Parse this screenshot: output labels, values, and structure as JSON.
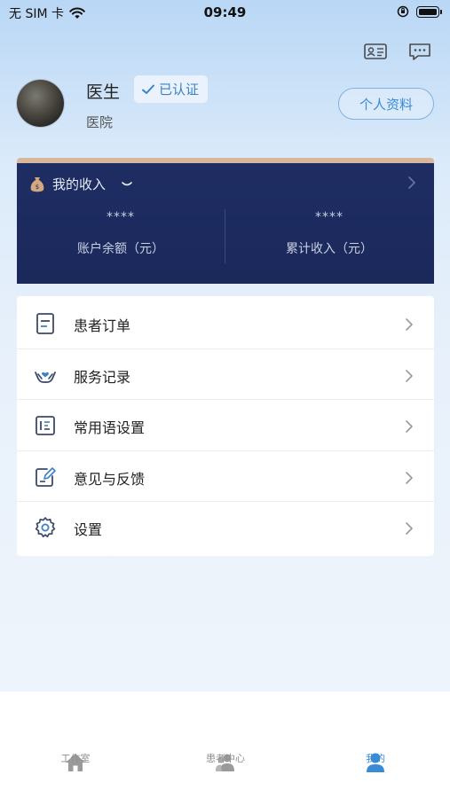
{
  "status_bar": {
    "carrier": "无 SIM 卡",
    "time": "09:49"
  },
  "profile": {
    "name": "医生",
    "verified_label": "已认证",
    "hospital": "医院",
    "profile_button": "个人资料"
  },
  "income": {
    "title": "我的收入",
    "balance_value": "****",
    "balance_label": "账户余额（元）",
    "total_value": "****",
    "total_label": "累计收入（元）"
  },
  "menu": {
    "items": [
      {
        "label": "患者订单",
        "icon": "document-icon"
      },
      {
        "label": "服务记录",
        "icon": "care-hands-icon"
      },
      {
        "label": "常用语设置",
        "icon": "phrase-icon"
      },
      {
        "label": "意见与反馈",
        "icon": "feedback-edit-icon"
      },
      {
        "label": "设置",
        "icon": "gear-icon"
      }
    ]
  },
  "tabbar": {
    "tabs": [
      {
        "label": "工作室",
        "icon": "home-icon",
        "active": false
      },
      {
        "label": "患者中心",
        "icon": "patients-icon",
        "active": false
      },
      {
        "label": "我的",
        "icon": "user-icon",
        "active": true
      }
    ]
  },
  "colors": {
    "accent": "#3a8ad6",
    "income_card": "#1e2d63",
    "tab_inactive": "#8f8f8f"
  }
}
